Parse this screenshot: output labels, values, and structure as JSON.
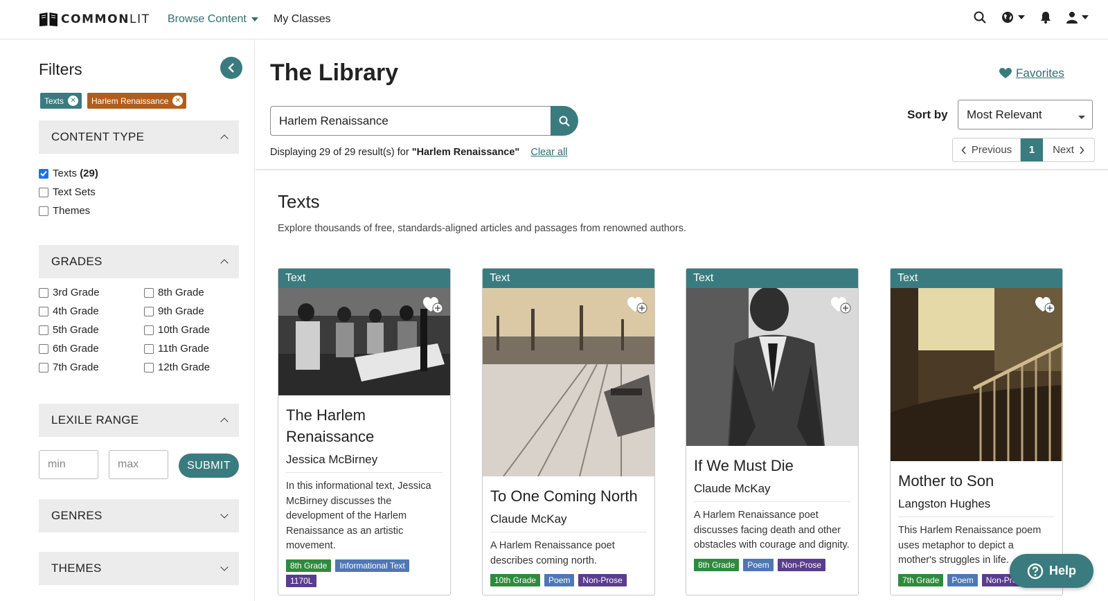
{
  "brand": {
    "bold": "COMMON",
    "light": "LIT"
  },
  "nav": {
    "browse": "Browse Content",
    "classes": "My Classes"
  },
  "sidebar": {
    "title": "Filters",
    "chips": [
      "Texts",
      "Harlem Renaissance"
    ],
    "content_type": {
      "label": "CONTENT TYPE",
      "options": [
        {
          "label": "Texts",
          "count": "(29)",
          "checked": true
        },
        {
          "label": "Text Sets",
          "checked": false
        },
        {
          "label": "Themes",
          "checked": false
        }
      ]
    },
    "grades": {
      "label": "GRADES",
      "left": [
        "3rd Grade",
        "4th Grade",
        "5th Grade",
        "6th Grade",
        "7th Grade"
      ],
      "right": [
        "8th Grade",
        "9th Grade",
        "10th Grade",
        "11th Grade",
        "12th Grade"
      ]
    },
    "lexile": {
      "label": "LEXILE RANGE",
      "min_placeholder": "min",
      "max_placeholder": "max",
      "submit": "SUBMIT"
    },
    "genres": {
      "label": "GENRES"
    },
    "themes": {
      "label": "THEMES"
    }
  },
  "main": {
    "title": "The Library",
    "favorites": "Favorites",
    "search_value": "Harlem Renaissance",
    "results_prefix": "Displaying 29 of 29 result(s) for ",
    "results_query": "\"Harlem Renaissance\"",
    "clear_all": "Clear all",
    "sort_label": "Sort by",
    "sort_value": "Most Relevant",
    "pager": {
      "prev": "Previous",
      "current": "1",
      "next": "Next"
    },
    "section_title": "Texts",
    "section_desc": "Explore thousands of free, standards-aligned articles and passages from renowned authors."
  },
  "cards": [
    {
      "band": "Text",
      "title": "The Harlem Renaissance",
      "author": "Jessica McBirney",
      "desc": "In this informational text, Jessica McBirney discusses the development of the Harlem Renaissance as an artistic movement.",
      "tags": [
        {
          "text": "8th Grade",
          "color": "green"
        },
        {
          "text": "Informational Text",
          "color": "blue"
        },
        {
          "text": "1170L",
          "color": "purple"
        }
      ]
    },
    {
      "band": "Text",
      "title": "To One Coming North",
      "author": "Claude McKay",
      "desc": "A Harlem Renaissance poet describes coming north.",
      "tags": [
        {
          "text": "10th Grade",
          "color": "green"
        },
        {
          "text": "Poem",
          "color": "blue"
        },
        {
          "text": "Non-Prose",
          "color": "purple"
        }
      ]
    },
    {
      "band": "Text",
      "title": "If We Must Die",
      "author": "Claude McKay",
      "desc": "A Harlem Renaissance poet discusses facing death and other obstacles with courage and dignity.",
      "tags": [
        {
          "text": "8th Grade",
          "color": "green"
        },
        {
          "text": "Poem",
          "color": "blue"
        },
        {
          "text": "Non-Prose",
          "color": "purple"
        }
      ]
    },
    {
      "band": "Text",
      "title": "Mother to Son",
      "author": "Langston Hughes",
      "desc": "This Harlem Renaissance poem uses metaphor to depict a mother's struggles in life.",
      "tags": [
        {
          "text": "7th Grade",
          "color": "green"
        },
        {
          "text": "Poem",
          "color": "blue"
        },
        {
          "text": "Non-Prose",
          "color": "purple"
        }
      ]
    }
  ],
  "help": "Help",
  "colors": {
    "accent": "#3a7b7f",
    "chip_orange": "#b35d1a",
    "tag_green": "#2f8a3e",
    "tag_blue": "#4f77b5",
    "tag_purple": "#5a3d8c"
  }
}
